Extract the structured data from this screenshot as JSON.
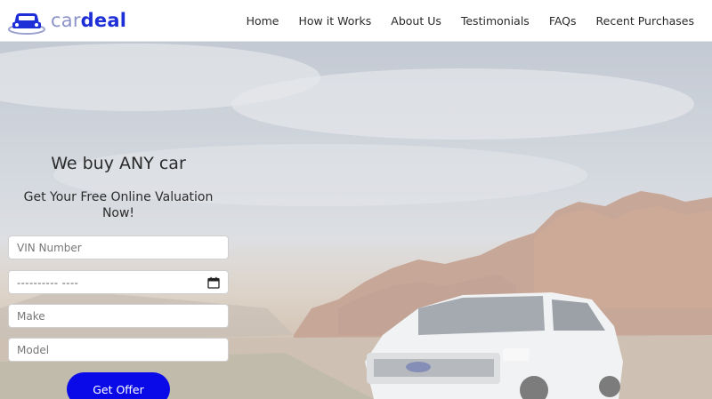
{
  "brand": {
    "logo_part1": "car",
    "logo_part2": "deal"
  },
  "nav": {
    "items": [
      "Home",
      "How it Works",
      "About Us",
      "Testimonials",
      "FAQs",
      "Recent Purchases"
    ]
  },
  "hero": {
    "heading": "We buy ANY car",
    "subheading": "Get Your Free Online Valuation Now!"
  },
  "form": {
    "vin_placeholder": "VIN Number",
    "date_value": "---------- ----",
    "make_placeholder": "Make",
    "model_placeholder": "Model",
    "submit_label": "Get Offer"
  },
  "colors": {
    "accent": "#0a0ae8",
    "logo_blue": "#1f2fd8",
    "logo_light": "#8d93c9"
  }
}
